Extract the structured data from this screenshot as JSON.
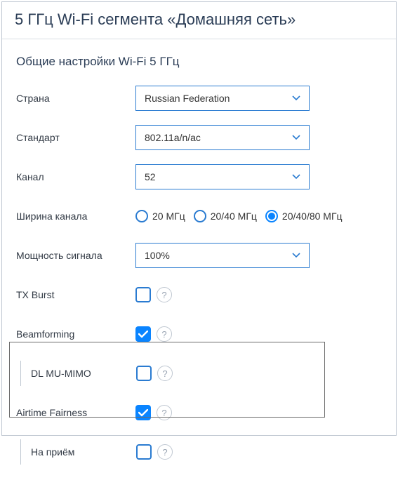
{
  "header": {
    "title": "5 ГГц Wi-Fi сегмента «Домашняя сеть»"
  },
  "section_title": "Общие настройки Wi-Fi 5 ГГц",
  "fields": {
    "country": {
      "label": "Страна",
      "value": "Russian Federation"
    },
    "standard": {
      "label": "Стандарт",
      "value": "802.11a/n/ac"
    },
    "channel": {
      "label": "Канал",
      "value": "52"
    },
    "width": {
      "label": "Ширина канала",
      "options": [
        "20 МГц",
        "20/40 МГц",
        "20/40/80 МГц"
      ],
      "selected": 2
    },
    "power": {
      "label": "Мощность сигнала",
      "value": "100%"
    },
    "txburst": {
      "label": "TX Burst",
      "checked": false
    },
    "beamforming": {
      "label": "Beamforming",
      "checked": true
    },
    "dlmumimo": {
      "label": "DL MU-MIMO",
      "checked": false
    },
    "airtime": {
      "label": "Airtime Fairness",
      "checked": true
    },
    "inbound": {
      "label": "На приём",
      "checked": false
    }
  },
  "help_glyph": "?"
}
